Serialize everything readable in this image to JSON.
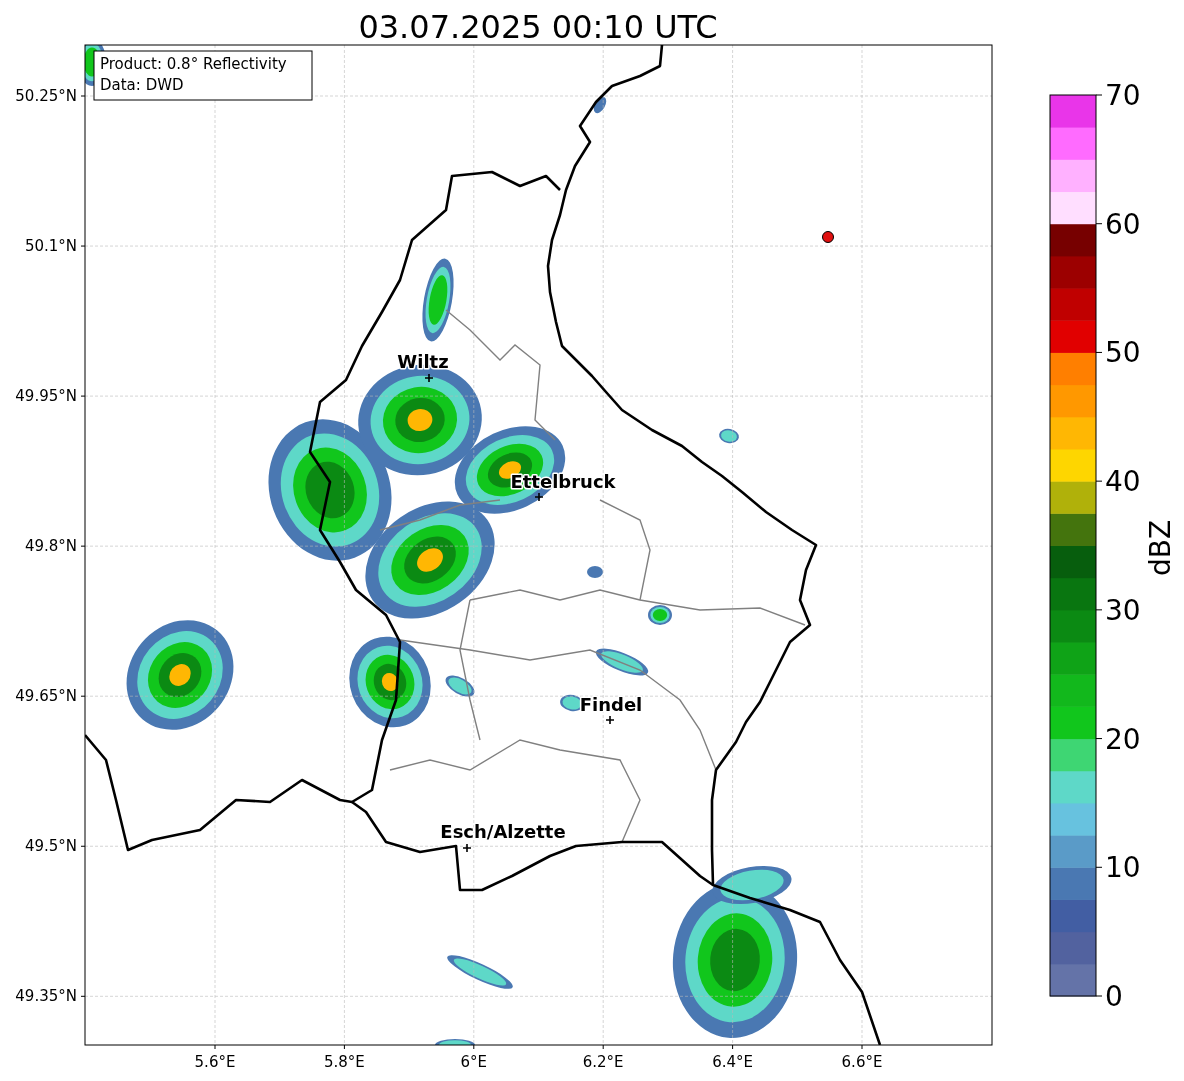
{
  "title": "03.07.2025 00:10 UTC",
  "map": {
    "info_box": [
      "Product: 0.8° Reflectivity",
      "Data: DWD"
    ],
    "xticks": [
      "5.6°E",
      "5.8°E",
      "6°E",
      "6.2°E",
      "6.4°E",
      "6.6°E"
    ],
    "yticks": [
      "50.25°N",
      "50.1°N",
      "49.95°N",
      "49.8°N",
      "49.65°N",
      "49.5°N",
      "49.35°N"
    ],
    "places": [
      {
        "name": "Wiltz"
      },
      {
        "name": "Ettelbruck"
      },
      {
        "name": "Findel"
      },
      {
        "name": "Esch/Alzette"
      }
    ]
  },
  "colorbar": {
    "label": "dBZ",
    "ticks": [
      "70",
      "60",
      "50",
      "40",
      "30",
      "20",
      "10",
      "0"
    ],
    "levels": [
      {
        "color": "#6473a8"
      },
      {
        "color": "#52629f"
      },
      {
        "color": "#425ea3"
      },
      {
        "color": "#4a78b2"
      },
      {
        "color": "#5a9bc8"
      },
      {
        "color": "#67c2df"
      },
      {
        "color": "#5ed8c8"
      },
      {
        "color": "#3ed673"
      },
      {
        "color": "#11c61c"
      },
      {
        "color": "#12b81c"
      },
      {
        "color": "#0fa317"
      },
      {
        "color": "#0b8a13"
      },
      {
        "color": "#097610"
      },
      {
        "color": "#075e0d"
      },
      {
        "color": "#44740d"
      },
      {
        "color": "#b0b10a"
      },
      {
        "color": "#fed600"
      },
      {
        "color": "#ffb703"
      },
      {
        "color": "#ff9800"
      },
      {
        "color": "#ff7f00"
      },
      {
        "color": "#e10000"
      },
      {
        "color": "#c00000"
      },
      {
        "color": "#9c0000"
      },
      {
        "color": "#770000"
      },
      {
        "color": "#ffdeff"
      },
      {
        "color": "#ffb1ff"
      },
      {
        "color": "#ff6bff"
      },
      {
        "color": "#e935e9"
      }
    ]
  }
}
